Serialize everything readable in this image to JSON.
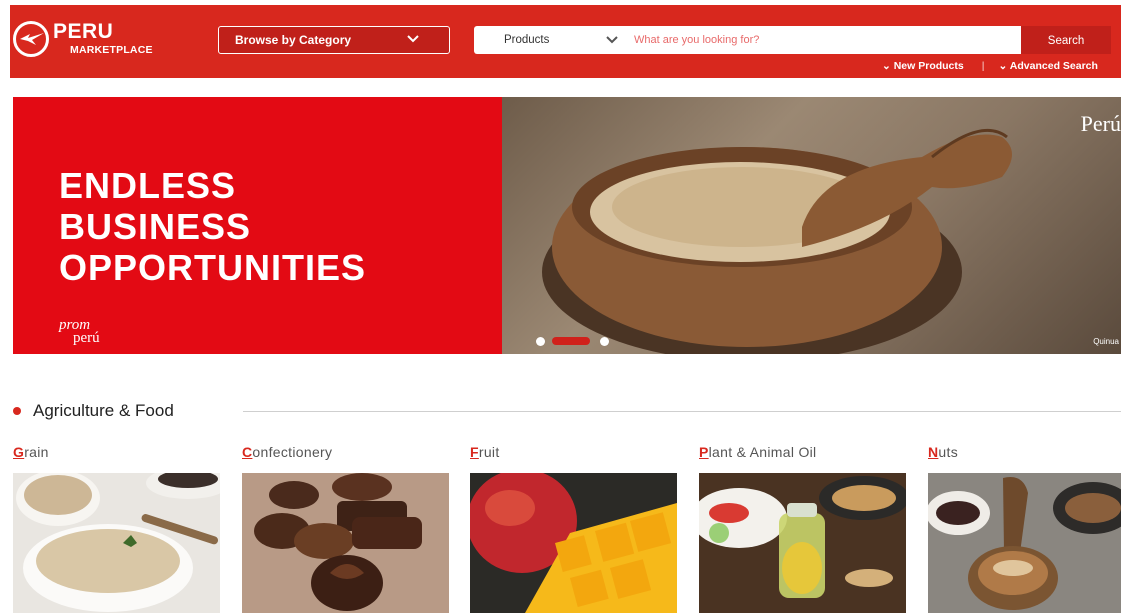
{
  "header": {
    "logo_top": "PERU",
    "logo_bottom": "MARKETPLACE",
    "browse_label": "Browse by Category",
    "search_scope": "Products",
    "search_placeholder": "What are you looking for?",
    "search_button": "Search",
    "links": [
      "New Products",
      "Advanced Search"
    ]
  },
  "banner": {
    "lines": [
      "ENDLESS",
      "BUSINESS",
      "OPPORTUNITIES"
    ],
    "brand_top": "prom",
    "brand_bottom": "perú",
    "photo_mark": "Perú",
    "photo_caption": "Quinua",
    "slides": 3,
    "active_slide": 2
  },
  "section": {
    "title": "Agriculture & Food",
    "categories": [
      {
        "first": "G",
        "rest": "rain",
        "image": "quinoa-bowls"
      },
      {
        "first": "C",
        "rest": "onfectionery",
        "image": "chocolates"
      },
      {
        "first": "F",
        "rest": "ruit",
        "image": "mango-fruit"
      },
      {
        "first": "P",
        "rest": "lant & Animal Oil",
        "image": "oil-and-nuts"
      },
      {
        "first": "N",
        "rest": "uts",
        "image": "brazil-nuts"
      }
    ]
  },
  "colors": {
    "brand_red": "#d8281e",
    "banner_red": "#e30a14"
  }
}
